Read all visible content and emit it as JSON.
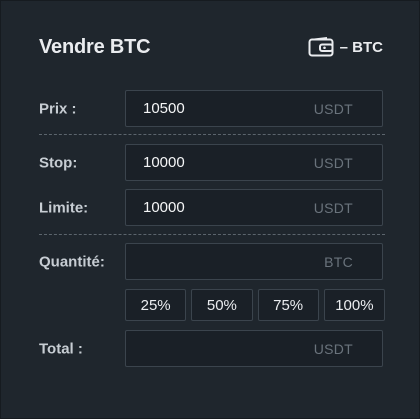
{
  "header": {
    "title": "Vendre BTC",
    "wallet_label": "– BTC"
  },
  "price": {
    "label": "Prix :",
    "value": "10500",
    "unit": "USDT"
  },
  "stop": {
    "label": "Stop:",
    "value": "10000",
    "unit": "USDT"
  },
  "limit": {
    "label": "Limite:",
    "value": "10000",
    "unit": "USDT"
  },
  "quantity": {
    "label": "Quantité:",
    "value": "",
    "unit": "BTC"
  },
  "percentages": [
    "25%",
    "50%",
    "75%",
    "100%"
  ],
  "total": {
    "label": "Total :",
    "value": "",
    "unit": "USDT"
  },
  "icons": {
    "wallet": "wallet-icon"
  },
  "colors": {
    "background": "#1f262d",
    "field_border": "#3b444d",
    "unit_text": "#6a737c",
    "label_text": "#c7cdd3"
  }
}
